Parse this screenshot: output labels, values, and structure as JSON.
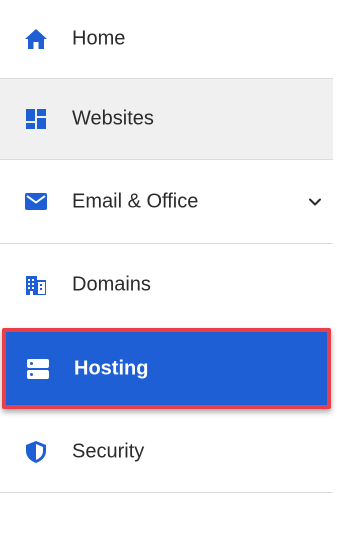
{
  "nav": {
    "items": [
      {
        "label": "Home",
        "icon": "home-icon"
      },
      {
        "label": "Websites",
        "icon": "websites-icon"
      },
      {
        "label": "Email & Office",
        "icon": "envelope-icon",
        "expandable": true
      },
      {
        "label": "Domains",
        "icon": "domains-icon"
      },
      {
        "label": "Hosting",
        "icon": "server-icon",
        "selected": true
      },
      {
        "label": "Security",
        "icon": "shield-icon"
      }
    ]
  },
  "colors": {
    "accent": "#1f5fd6",
    "highlight_border": "#e8404b",
    "hover_bg": "#f0f0f0",
    "text": "#2b2b2b"
  }
}
